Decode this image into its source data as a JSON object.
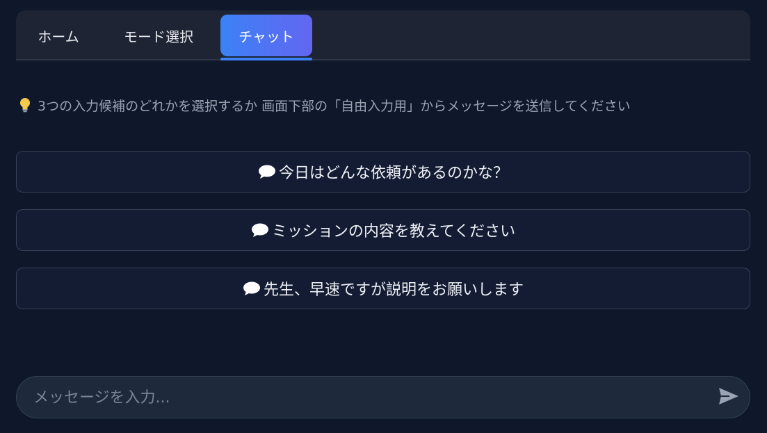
{
  "tabs": [
    {
      "label": "ホーム",
      "active": false
    },
    {
      "label": "モード選択",
      "active": false
    },
    {
      "label": "チャット",
      "active": true
    }
  ],
  "hint": {
    "icon": "lightbulb-icon",
    "text": "3つの入力候補のどれかを選択するか 画面下部の「自由入力用」からメッセージを送信してください"
  },
  "suggestions": [
    {
      "icon": "speech-bubble-icon",
      "label": "今日はどんな依頼があるのかな？"
    },
    {
      "icon": "speech-bubble-icon",
      "label": "ミッションの内容を教えてください"
    },
    {
      "icon": "speech-bubble-icon",
      "label": "先生、早速ですが説明をお願いします"
    }
  ],
  "composer": {
    "placeholder": "メッセージを入力...",
    "value": "",
    "send_icon": "send-icon"
  },
  "colors": {
    "background": "#0f172a",
    "accent_start": "#3b82f6",
    "accent_end": "#6366f1"
  }
}
